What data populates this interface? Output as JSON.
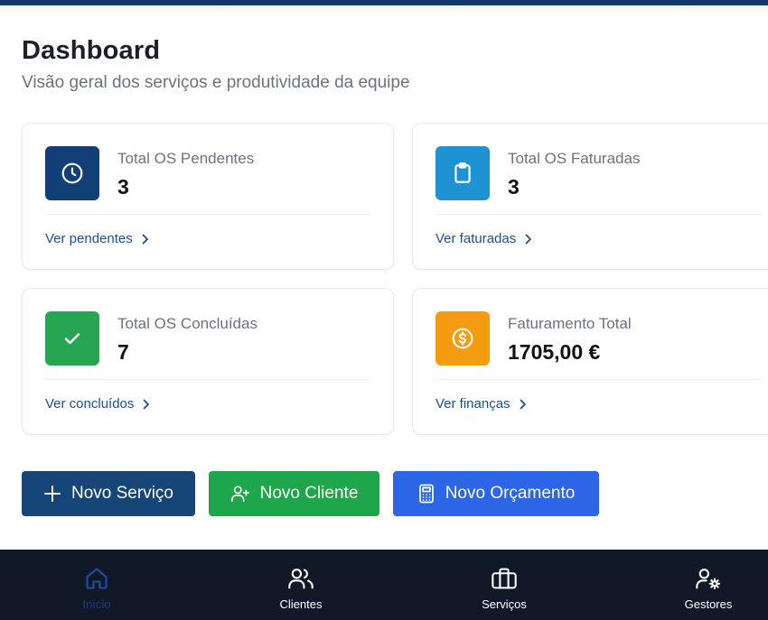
{
  "header": {
    "title": "Dashboard",
    "subtitle": "Visão geral dos serviços e produtividade da equipe"
  },
  "cards": [
    {
      "label": "Total OS Pendentes",
      "value": "3",
      "link": "Ver pendentes",
      "icon": "clock-icon",
      "color": "#123f75"
    },
    {
      "label": "Total OS Faturadas",
      "value": "3",
      "link": "Ver faturadas",
      "icon": "clipboard-icon",
      "color": "#1f92d3"
    },
    {
      "label": "Total OS Concluídas",
      "value": "7",
      "link": "Ver concluídos",
      "icon": "check-icon",
      "color": "#27a552"
    },
    {
      "label": "Faturamento Total",
      "value": "1705,00 €",
      "link": "Ver finanças",
      "icon": "dollar-circle-icon",
      "color": "#f39c0f"
    }
  ],
  "actions": [
    {
      "label": "Novo Serviço",
      "icon": "plus-icon",
      "color": "#164578"
    },
    {
      "label": "Novo Cliente",
      "icon": "user-plus-icon",
      "color": "#1ea64b"
    },
    {
      "label": "Novo Orçamento",
      "icon": "calculator-icon",
      "color": "#2c66e6"
    }
  ],
  "nav": {
    "active": "Início",
    "items": [
      {
        "label": "Início",
        "icon": "home-icon"
      },
      {
        "label": "Clientes",
        "icon": "users-icon"
      },
      {
        "label": "Serviços",
        "icon": "briefcase-icon"
      },
      {
        "label": "Gestores",
        "icon": "user-gear-icon"
      }
    ]
  },
  "colors": {
    "top_bar": "#123a66",
    "bottom_nav": "#111827",
    "link": "#1e4e8c",
    "nav_active": "#1e3a8a"
  }
}
